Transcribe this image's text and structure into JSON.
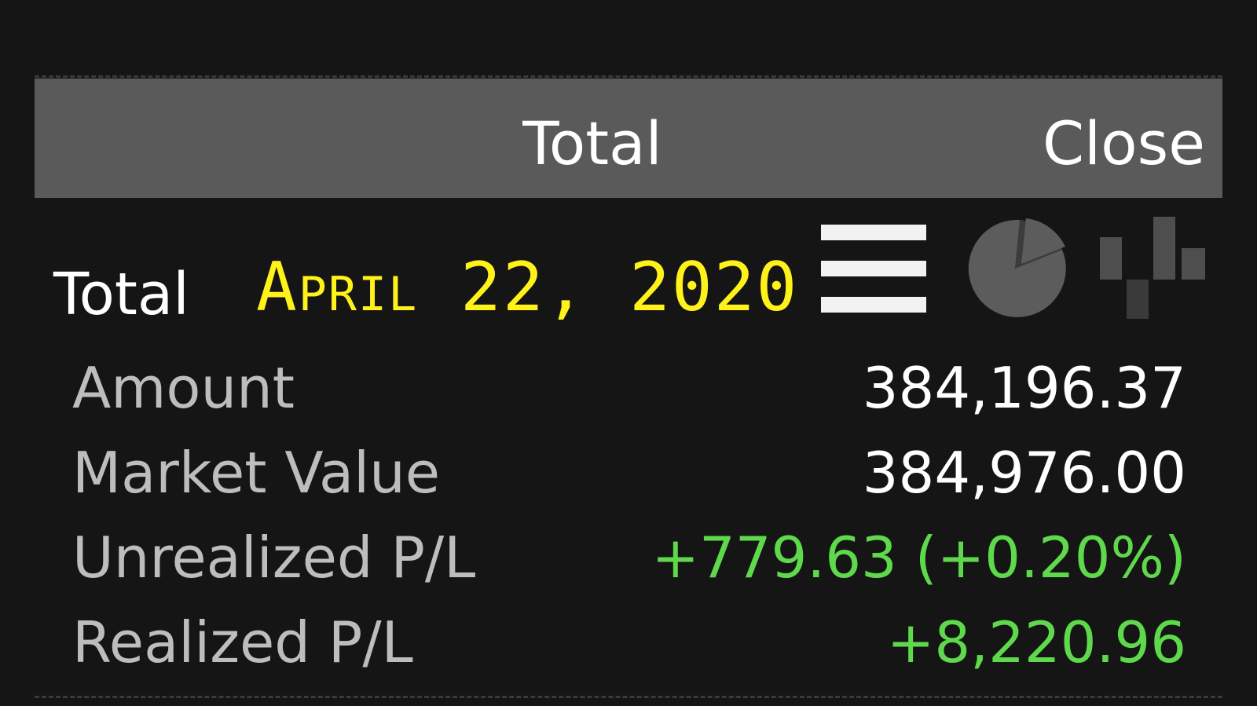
{
  "header": {
    "title": "Total",
    "close_label": "Close"
  },
  "summary": {
    "section_title": "Total",
    "date_stamp": "April 22, 2020",
    "view_icons": [
      "list-icon",
      "pie-chart-icon",
      "bar-chart-icon"
    ]
  },
  "rows": [
    {
      "label": "Amount",
      "value": "384,196.37"
    },
    {
      "label": "Market Value",
      "value": "384,976.00"
    },
    {
      "label": "Unrealized P/L",
      "value": "+779.63 (+0.20%)"
    },
    {
      "label": "Realized P/L",
      "value": "+8,220.96"
    }
  ],
  "colors": {
    "background": "#151515",
    "header": "#5a5a5a",
    "positive": "#5fd94c",
    "date_stamp": "#fff21a",
    "label": "#bdbdbd"
  }
}
